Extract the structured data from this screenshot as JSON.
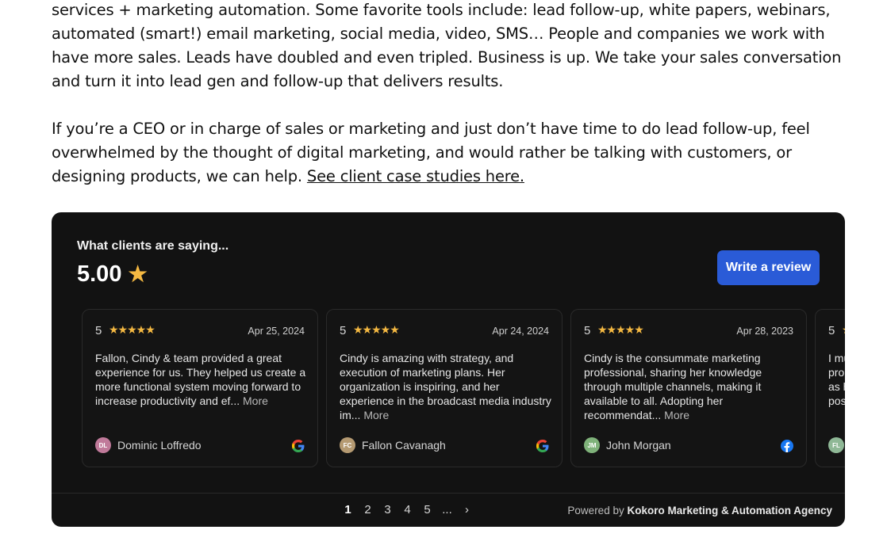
{
  "prose": {
    "p1": "services + marketing automation. Some favorite tools include: lead follow-up, white papers, webinars, automated (smart!) email marketing, social media, video, SMS… People and companies we work with have more sales. Leads have doubled and even tripled. Business is up. We take your sales conversation and turn it into lead gen and follow-up that delivers results.",
    "p2": "If you’re a CEO or in charge of sales or marketing and just don’t have time to do lead follow-up, feel overwhelmed by the thought of digital marketing, and would rather be talking with customers, or designing products, we can help. ",
    "link": "See client case studies here."
  },
  "widget": {
    "title": "What clients are saying...",
    "rating": "5.00",
    "write_review": "Write a review",
    "star_color": "#f5b942",
    "button_color": "#2a5bd7",
    "reviews": [
      {
        "score": "5",
        "stars": "★★★★★",
        "date": "Apr 25, 2024",
        "text": "Fallon, Cindy & team provided a great experience for us. They helped us create a more functional system moving forward to increase productivity and ef...",
        "more": "More",
        "initials": "DL",
        "avatar_color": "#c07a9a",
        "name": "Dominic Loffredo",
        "source": "google"
      },
      {
        "score": "5",
        "stars": "★★★★★",
        "date": "Apr 24, 2024",
        "text": "Cindy is amazing with strategy, and execution of marketing plans. Her organization is inspiring, and her experience in the broadcast media industry im...",
        "more": "More",
        "initials": "FC",
        "avatar_color": "#b59a72",
        "name": "Fallon Cavanagh",
        "source": "google"
      },
      {
        "score": "5",
        "stars": "★★★★★",
        "date": "Apr 28, 2023",
        "text": "Cindy is the consummate marketing professional, sharing her knowledge through multiple channels, making it available to all. Adopting her recommendat...",
        "more": "More",
        "initials": "JM",
        "avatar_color": "#7fb27a",
        "name": "John Morgan",
        "source": "facebook"
      },
      {
        "score": "5",
        "stars": "★★★★★",
        "date": "",
        "text": "I mu pro as h pos",
        "more": "",
        "initials": "FL",
        "avatar_color": "#8fb896",
        "name": "",
        "source": ""
      }
    ],
    "pager": [
      "1",
      "2",
      "3",
      "4",
      "5",
      "...",
      "›"
    ],
    "powered_prefix": "Powered by ",
    "powered_name": "Kokoro Marketing & Automation Agency"
  }
}
